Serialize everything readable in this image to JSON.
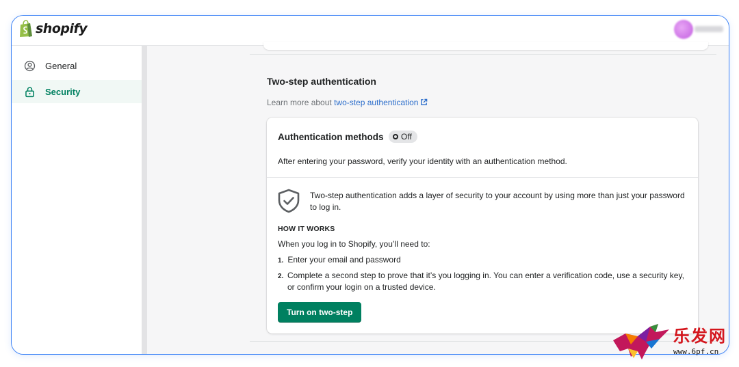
{
  "brand": {
    "name": "shopify"
  },
  "sidebar": {
    "items": [
      {
        "label": "General",
        "icon": "user-circle-icon"
      },
      {
        "label": "Security",
        "icon": "lock-icon"
      }
    ]
  },
  "section": {
    "title": "Two-step authentication",
    "learn_more_prefix": "Learn more about ",
    "learn_more_link": "two-step authentication"
  },
  "card": {
    "title": "Authentication methods",
    "status": "Off",
    "description": "After entering your password, verify your identity with an authentication method.",
    "info": "Two-step authentication adds a layer of security to your account by using more than just your password to log in.",
    "how_title": "HOW IT WORKS",
    "how_intro": "When you log in to Shopify, you’ll need to:",
    "steps": [
      {
        "num": "1.",
        "text": "Enter your email and password"
      },
      {
        "num": "2.",
        "text": "Complete a second step to prove that it’s you logging in. You can enter a verification code, use a security key, or confirm your login on a trusted device."
      }
    ],
    "button_label": "Turn on two-step"
  },
  "watermark": {
    "chars": "乐发网",
    "url": "www.6pf.cn"
  },
  "colors": {
    "accent": "#008060",
    "link": "#2c6ecb",
    "frame_border": "#3b82f6"
  }
}
